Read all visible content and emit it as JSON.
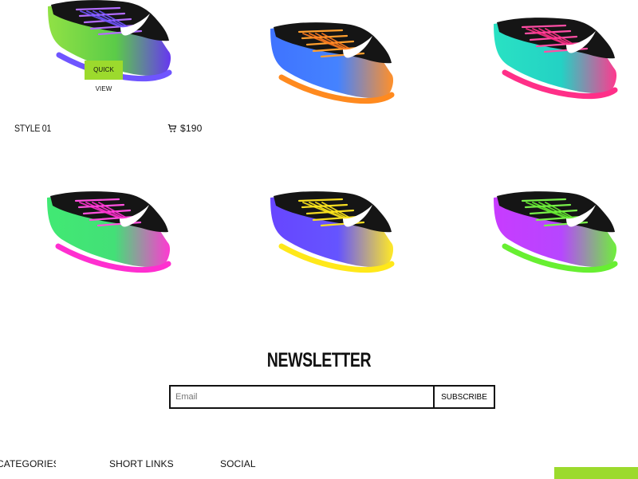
{
  "products": [
    {
      "quick_view_label": "QUICK VIEW",
      "style_name": "STYLE 01",
      "price": "$190",
      "colors": [
        "#8be03b",
        "#5f2df0"
      ]
    },
    {
      "colors": [
        "#356cff",
        "#ff8a1f"
      ]
    },
    {
      "colors": [
        "#1ee0c0",
        "#ff2f88"
      ]
    },
    {
      "colors": [
        "#37e86c",
        "#ff2fd0"
      ]
    },
    {
      "colors": [
        "#5f3cff",
        "#ffe81a"
      ]
    },
    {
      "colors": [
        "#c531ff",
        "#67ef31"
      ]
    }
  ],
  "newsletter": {
    "title": "NEWSLETTER",
    "email_placeholder": "Email",
    "subscribe_label": "SUBSCRIBE"
  },
  "footer": {
    "categories_label": "CATEGORIES",
    "short_links_label": "SHORT LINKS",
    "social_label": "SOCIAL"
  },
  "colors": {
    "accent": "#9cda2d",
    "text": "#111111",
    "shoe_body": "#151515"
  }
}
